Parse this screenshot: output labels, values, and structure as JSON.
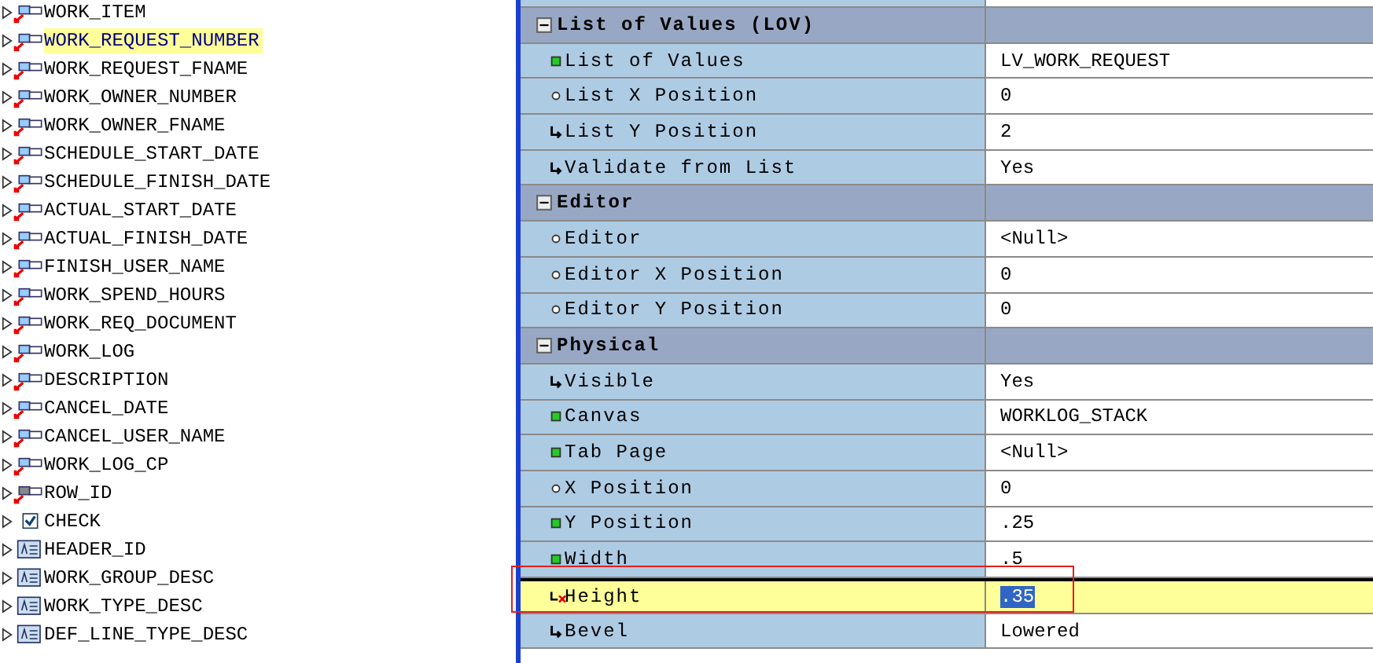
{
  "tree": {
    "items": [
      {
        "label": "WORK_ITEM",
        "kind": "text-item",
        "selected": false
      },
      {
        "label": "WORK_REQUEST_NUMBER",
        "kind": "text-item",
        "selected": true
      },
      {
        "label": "WORK_REQUEST_FNAME",
        "kind": "text-item",
        "selected": false
      },
      {
        "label": "WORK_OWNER_NUMBER",
        "kind": "text-item",
        "selected": false
      },
      {
        "label": "WORK_OWNER_FNAME",
        "kind": "text-item",
        "selected": false
      },
      {
        "label": "SCHEDULE_START_DATE",
        "kind": "text-item",
        "selected": false
      },
      {
        "label": "SCHEDULE_FINISH_DATE",
        "kind": "text-item",
        "selected": false
      },
      {
        "label": "ACTUAL_START_DATE",
        "kind": "text-item",
        "selected": false
      },
      {
        "label": "ACTUAL_FINISH_DATE",
        "kind": "text-item",
        "selected": false
      },
      {
        "label": "FINISH_USER_NAME",
        "kind": "text-item",
        "selected": false
      },
      {
        "label": "WORK_SPEND_HOURS",
        "kind": "text-item",
        "selected": false
      },
      {
        "label": "WORK_REQ_DOCUMENT",
        "kind": "text-item",
        "selected": false
      },
      {
        "label": "WORK_LOG",
        "kind": "text-item",
        "selected": false
      },
      {
        "label": "DESCRIPTION",
        "kind": "text-item",
        "selected": false
      },
      {
        "label": "CANCEL_DATE",
        "kind": "text-item",
        "selected": false
      },
      {
        "label": "CANCEL_USER_NAME",
        "kind": "text-item",
        "selected": false
      },
      {
        "label": "WORK_LOG_CP",
        "kind": "text-item",
        "selected": false
      },
      {
        "label": "ROW_ID",
        "kind": "hidden-item",
        "selected": false
      },
      {
        "label": "CHECK",
        "kind": "checkbox",
        "selected": false
      },
      {
        "label": "HEADER_ID",
        "kind": "display-item",
        "selected": false
      },
      {
        "label": "WORK_GROUP_DESC",
        "kind": "display-item",
        "selected": false
      },
      {
        "label": "WORK_TYPE_DESC",
        "kind": "display-item",
        "selected": false
      },
      {
        "label": "DEF_LINE_TYPE_DESC",
        "kind": "display-item",
        "selected": false
      }
    ]
  },
  "properties": {
    "rows": [
      {
        "kind": "group",
        "label": "List of Values (LOV)",
        "expanded": true
      },
      {
        "kind": "default",
        "label": "List of Values",
        "value": "LV_WORK_REQUEST",
        "selected": false
      },
      {
        "kind": "inherited",
        "label": "List X Position",
        "value": "0",
        "selected": false
      },
      {
        "kind": "changed",
        "label": "List Y Position",
        "value": "2",
        "selected": false
      },
      {
        "kind": "changed",
        "label": "Validate from List",
        "value": "Yes",
        "selected": false
      },
      {
        "kind": "group",
        "label": "Editor",
        "expanded": true
      },
      {
        "kind": "inherited",
        "label": "Editor",
        "value": "<Null>",
        "selected": false
      },
      {
        "kind": "inherited",
        "label": "Editor X Position",
        "value": "0",
        "selected": false
      },
      {
        "kind": "inherited",
        "label": "Editor Y Position",
        "value": "0",
        "selected": false
      },
      {
        "kind": "group",
        "label": "Physical",
        "expanded": true
      },
      {
        "kind": "changed",
        "label": "Visible",
        "value": "Yes",
        "selected": false
      },
      {
        "kind": "default",
        "label": "Canvas",
        "value": "WORKLOG_STACK",
        "selected": false
      },
      {
        "kind": "default",
        "label": "Tab Page",
        "value": "<Null>",
        "selected": false
      },
      {
        "kind": "inherited",
        "label": "X Position",
        "value": "0",
        "selected": false
      },
      {
        "kind": "default",
        "label": "Y Position",
        "value": ".25",
        "selected": false
      },
      {
        "kind": "default",
        "label": "Width",
        "value": ".5",
        "selected": false
      },
      {
        "kind": "error",
        "label": "Height",
        "value": ".35",
        "selected": true
      },
      {
        "kind": "changed",
        "label": "Bevel",
        "value": "Lowered",
        "selected": false
      }
    ]
  }
}
